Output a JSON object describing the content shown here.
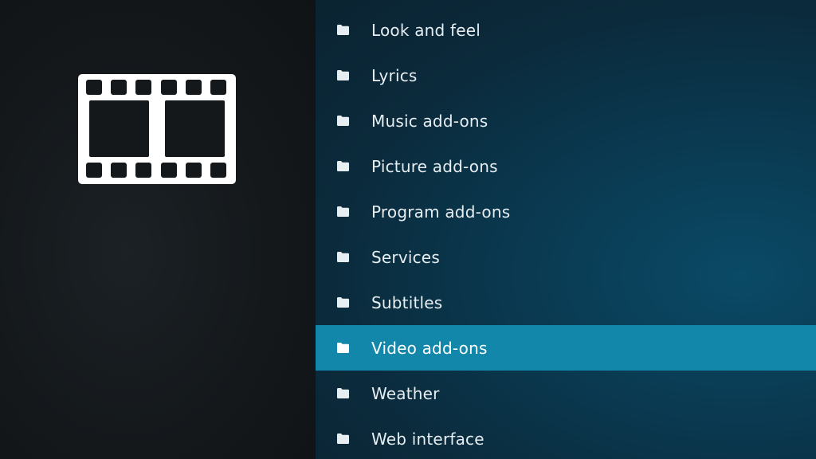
{
  "window": {
    "category_icon": "film-strip-icon"
  },
  "menu": {
    "items": [
      {
        "label": "Look and feel",
        "icon": "folder-icon",
        "selected": false
      },
      {
        "label": "Lyrics",
        "icon": "folder-icon",
        "selected": false
      },
      {
        "label": "Music add-ons",
        "icon": "folder-icon",
        "selected": false
      },
      {
        "label": "Picture add-ons",
        "icon": "folder-icon",
        "selected": false
      },
      {
        "label": "Program add-ons",
        "icon": "folder-icon",
        "selected": false
      },
      {
        "label": "Services",
        "icon": "folder-icon",
        "selected": false
      },
      {
        "label": "Subtitles",
        "icon": "folder-icon",
        "selected": false
      },
      {
        "label": "Video add-ons",
        "icon": "folder-icon",
        "selected": true
      },
      {
        "label": "Weather",
        "icon": "folder-icon",
        "selected": false
      },
      {
        "label": "Web interface",
        "icon": "folder-icon",
        "selected": false
      }
    ]
  },
  "colors": {
    "left_panel_bg": "#14181b",
    "right_panel_bg": "#0a3a52",
    "selected_bg": "#1287aa",
    "text": "#e6eef2",
    "icon": "#ffffff"
  }
}
